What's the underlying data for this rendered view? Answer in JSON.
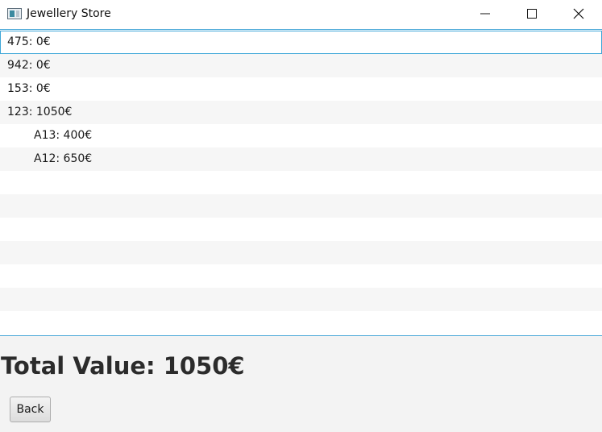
{
  "window": {
    "title": "Jewellery Store",
    "icon": "app-window-icon"
  },
  "tree": {
    "items": [
      {
        "label": "475: 0€",
        "level": 0
      },
      {
        "label": "942: 0€",
        "level": 0
      },
      {
        "label": "153: 0€",
        "level": 0
      },
      {
        "label": "123: 1050€",
        "level": 0
      },
      {
        "label": "A13: 400€",
        "level": 1
      },
      {
        "label": "A12: 650€",
        "level": 1
      }
    ],
    "focused_index": 0
  },
  "footer": {
    "total_label": "Total Value: 1050€",
    "back_label": "Back"
  },
  "colors": {
    "accent_border": "#4aa8d8",
    "row_alt": "#f6f6f6",
    "footer_bg": "#f3f3f3"
  }
}
